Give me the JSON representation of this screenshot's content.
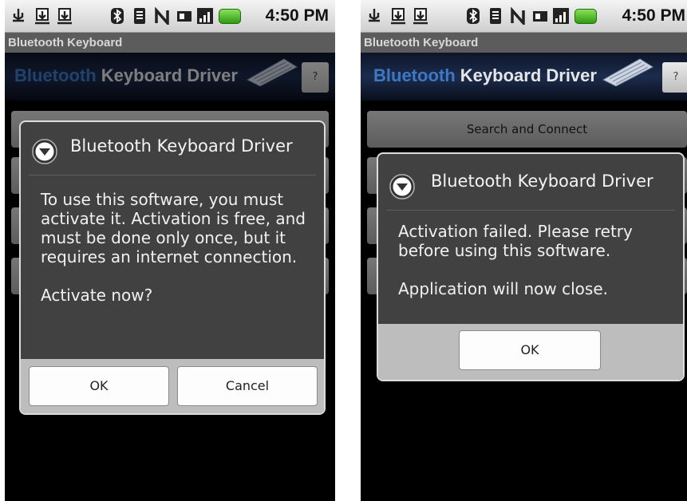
{
  "status_bar": {
    "time": "4:50 PM"
  },
  "window_title": "Bluetooth Keyboard",
  "banner": {
    "word_blue": "Bluetooth",
    "word_white": "Keyboard Driver",
    "help_label": "?"
  },
  "menu": {
    "search_connect_label": "Search and Connect"
  },
  "dialog_activate": {
    "title": "Bluetooth Keyboard Driver",
    "message": "To use this software, you must activate it. Activation is free, and must be done only once, but it requires an internet connection.\n\nActivate now?",
    "ok_label": "OK",
    "cancel_label": "Cancel"
  },
  "dialog_failed": {
    "title": "Bluetooth Keyboard Driver",
    "message": "Activation failed. Please retry before using this software.\n\nApplication will now close.",
    "ok_label": "OK"
  },
  "colors": {
    "battery": "#3fae1c",
    "banner_blue": "#3c78c4",
    "dialog_bg": "#404140"
  },
  "icons": [
    "usb-icon",
    "download-icon",
    "download-icon",
    "bluetooth-icon",
    "wifi-icon",
    "nfc-icon",
    "sd-card-icon",
    "signal-icon",
    "battery-icon"
  ]
}
